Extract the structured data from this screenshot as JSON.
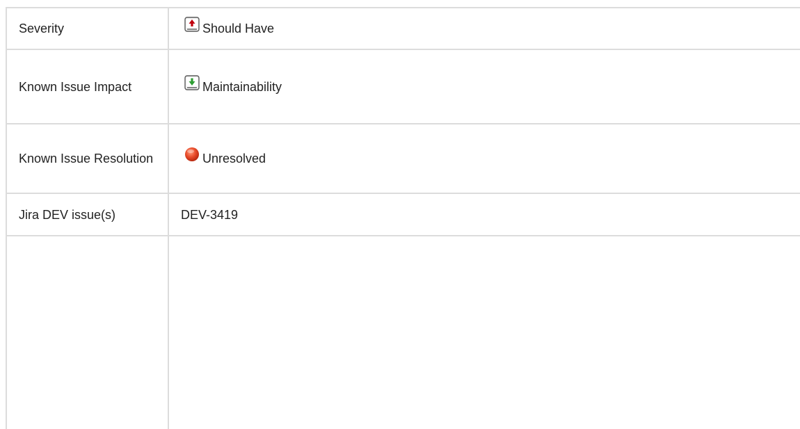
{
  "table": {
    "rows": [
      {
        "label": "Severity",
        "value": "Should Have",
        "icon": "priority-up-red-icon"
      },
      {
        "label": "Known Issue Impact",
        "value": "Maintainability",
        "icon": "priority-down-green-icon"
      },
      {
        "label": "Known Issue Resolution",
        "value": "Unresolved",
        "icon": "red-circle-status-icon"
      },
      {
        "label": "Jira DEV issue(s)",
        "value": "DEV-3419",
        "icon": ""
      },
      {
        "label": "",
        "value": "",
        "icon": ""
      }
    ]
  },
  "colors": {
    "border": "#dcdcdc",
    "text": "#222222",
    "severity_icon": "#c0000d",
    "impact_icon": "#2e9e33",
    "resolution_icon": "#e84b2a"
  }
}
